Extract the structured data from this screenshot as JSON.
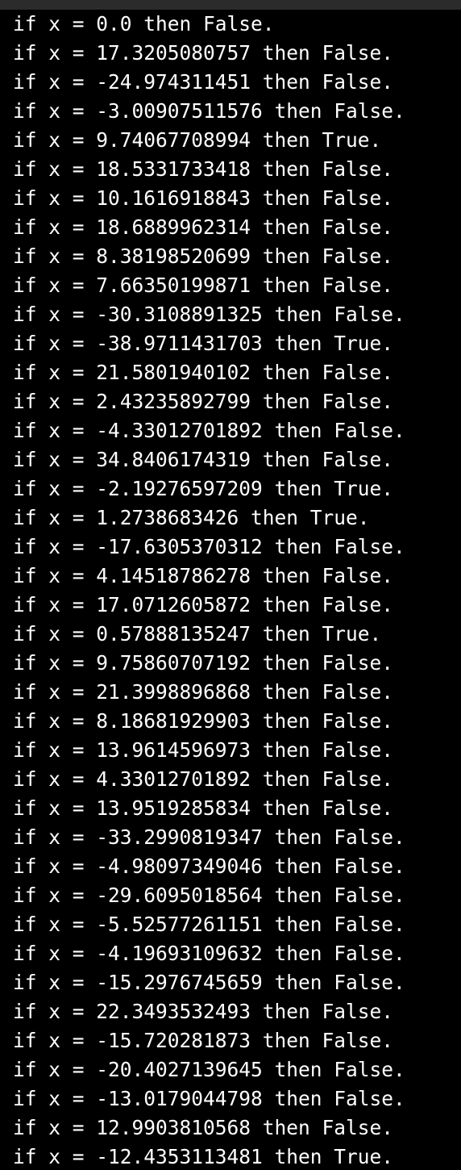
{
  "terminal": {
    "lines": [
      "if x = 0.0 then False.",
      "if x = 17.3205080757 then False.",
      "if x = -24.974311451 then False.",
      "if x = -3.00907511576 then False.",
      "if x = 9.74067708994 then True.",
      "if x = 18.5331733418 then False.",
      "if x = 10.1616918843 then False.",
      "if x = 18.6889962314 then False.",
      "if x = 8.38198520699 then False.",
      "if x = 7.66350199871 then False.",
      "if x = -30.3108891325 then False.",
      "if x = -38.9711431703 then True.",
      "if x = 21.5801940102 then False.",
      "if x = 2.43235892799 then False.",
      "if x = -4.33012701892 then False.",
      "if x = 34.8406174319 then False.",
      "if x = -2.19276597209 then True.",
      "if x = 1.2738683426 then True.",
      "if x = -17.6305370312 then False.",
      "if x = 4.14518786278 then False.",
      "if x = 17.0712605872 then False.",
      "if x = 0.57888135247 then True.",
      "if x = 9.75860707192 then False.",
      "if x = 21.3998896868 then False.",
      "if x = 8.18681929903 then False.",
      "if x = 13.9614596973 then False.",
      "if x = 4.33012701892 then False.",
      "if x = 13.9519285834 then False.",
      "if x = -33.2990819347 then False.",
      "if x = -4.98097349046 then False.",
      "if x = -29.6095018564 then False.",
      "if x = -5.52577261151 then False.",
      "if x = -4.19693109632 then False.",
      "if x = -15.2976745659 then False.",
      "if x = 22.3493532493 then False.",
      "if x = -15.720281873 then False.",
      "if x = -20.4027139645 then False.",
      "if x = -13.0179044798 then False.",
      "if x = 12.9903810568 then False.",
      "if x = -12.4353113481 then True."
    ]
  }
}
